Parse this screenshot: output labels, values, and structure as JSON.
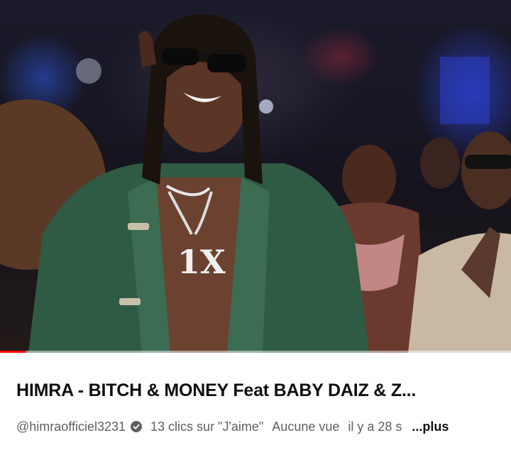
{
  "video": {
    "progress_fraction": 0.05,
    "progress_color": "#ff0000"
  },
  "title": "HIMRA - BITCH & MONEY Feat BABY DAIZ & Z...",
  "channel": "@himraofficiel3231",
  "verified_icon": "verified-badge-icon",
  "likes": "13 clics sur \"J'aime\"",
  "views": "Aucune vue",
  "time_ago": "il y a 28 s",
  "more": "...plus"
}
